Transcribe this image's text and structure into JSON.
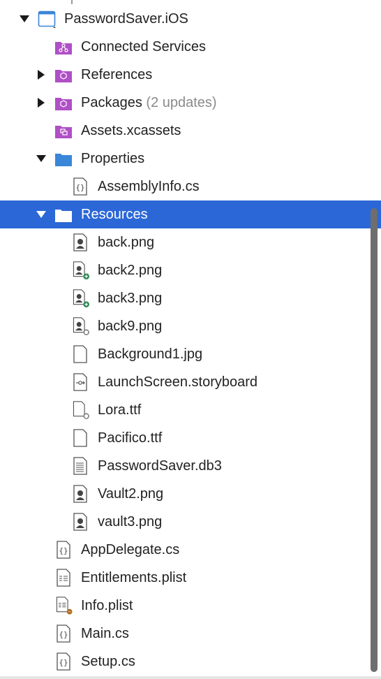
{
  "tree": {
    "items": [
      {
        "label": "PasswordSaver.iOS",
        "icon": "ios-project-icon",
        "expanded": true
      },
      {
        "label": "Connected Services",
        "icon": "connected-services-folder-icon"
      },
      {
        "label": "References",
        "icon": "references-folder-icon",
        "expanded": false
      },
      {
        "label": "Packages",
        "badge": "(2 updates)",
        "icon": "packages-folder-icon",
        "expanded": false
      },
      {
        "label": "Assets.xcassets",
        "icon": "assets-folder-icon"
      },
      {
        "label": "Properties",
        "icon": "folder-icon",
        "expanded": true
      },
      {
        "label": "AssemblyInfo.cs",
        "icon": "csharp-file-icon"
      },
      {
        "label": "Resources",
        "icon": "folder-icon",
        "expanded": true,
        "selected": true
      },
      {
        "label": "back.png",
        "icon": "image-file-icon"
      },
      {
        "label": "back2.png",
        "icon": "image-file-icon",
        "status": "added"
      },
      {
        "label": "back3.png",
        "icon": "image-file-icon",
        "status": "added"
      },
      {
        "label": "back9.png",
        "icon": "image-file-icon",
        "status": "missing"
      },
      {
        "label": "Background1.jpg",
        "icon": "blank-file-icon"
      },
      {
        "label": "LaunchScreen.storyboard",
        "icon": "storyboard-file-icon"
      },
      {
        "label": "Lora.ttf",
        "icon": "blank-file-icon",
        "status": "missing"
      },
      {
        "label": "Pacifico.ttf",
        "icon": "blank-file-icon"
      },
      {
        "label": "PasswordSaver.db3",
        "icon": "text-file-icon"
      },
      {
        "label": "Vault2.png",
        "icon": "image-file-icon"
      },
      {
        "label": "vault3.png",
        "icon": "image-file-icon"
      },
      {
        "label": "AppDelegate.cs",
        "icon": "csharp-file-icon"
      },
      {
        "label": "Entitlements.plist",
        "icon": "plist-file-icon"
      },
      {
        "label": "Info.plist",
        "icon": "plist-file-icon",
        "status": "warning"
      },
      {
        "label": "Main.cs",
        "icon": "csharp-file-icon"
      },
      {
        "label": "Setup.cs",
        "icon": "csharp-file-icon"
      }
    ]
  },
  "colors": {
    "selection": "#2b67d7",
    "purple_folder": "#b04fc6",
    "blue_folder": "#3a86d8",
    "added_badge": "#2e8b57",
    "warning_badge": "#b06d1e",
    "muted_text": "#8a8a8a"
  }
}
